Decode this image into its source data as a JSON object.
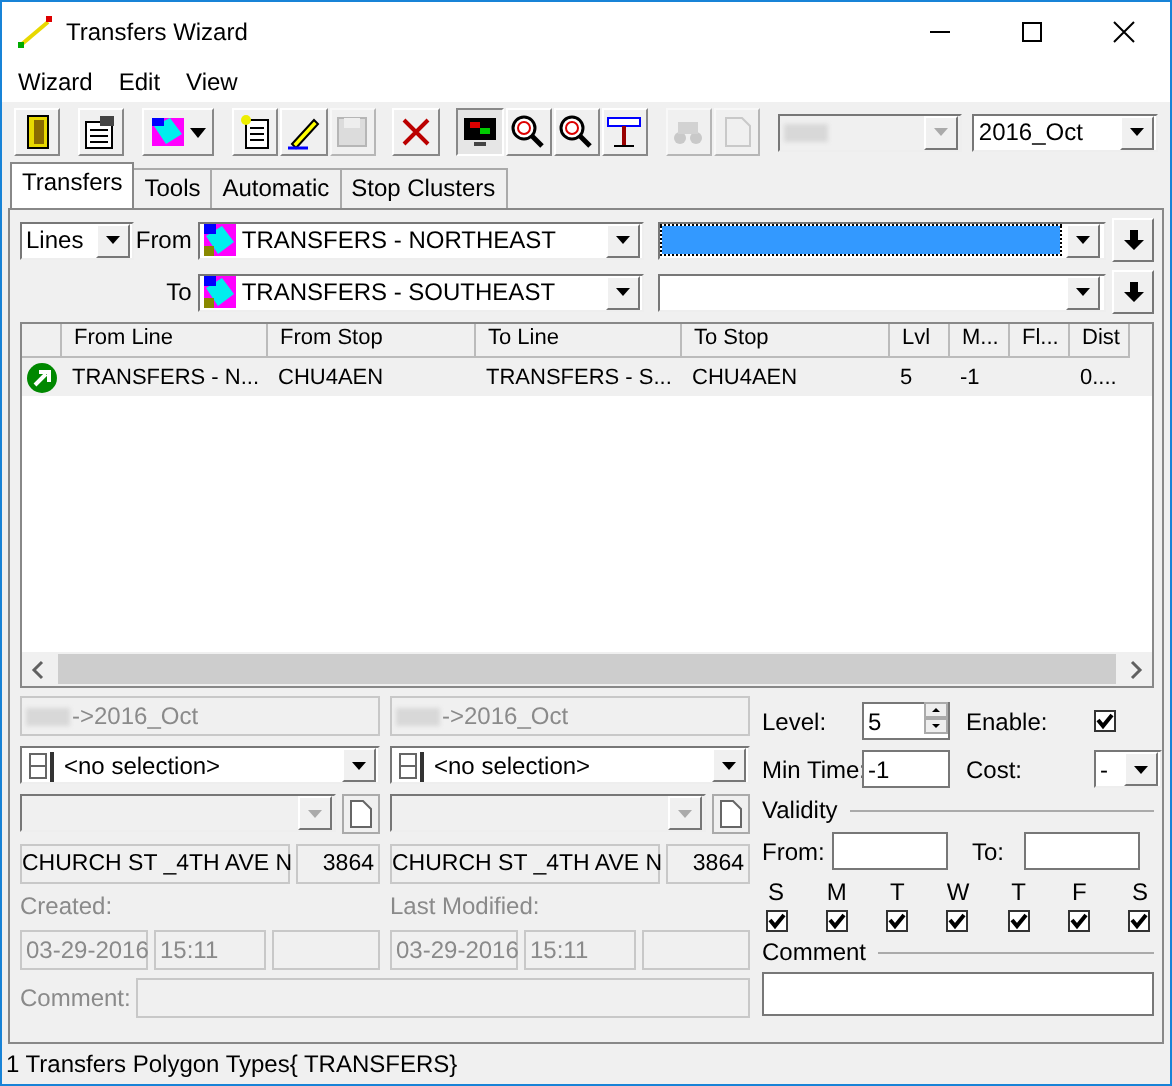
{
  "window": {
    "title": "Transfers Wizard"
  },
  "menu": [
    "Wizard",
    "Edit",
    "View"
  ],
  "toolbar": {
    "buttons": [
      {
        "kind": "door",
        "disabled": false,
        "pressed": false,
        "separator_before": false,
        "has_menu": false
      },
      {
        "kind": "properties",
        "disabled": false,
        "pressed": false,
        "separator_before": true,
        "has_menu": false
      },
      {
        "kind": "layers",
        "disabled": false,
        "pressed": false,
        "separator_before": true,
        "has_menu": true
      },
      {
        "kind": "new",
        "disabled": false,
        "pressed": false,
        "separator_before": true,
        "has_menu": false
      },
      {
        "kind": "pencil",
        "disabled": false,
        "pressed": false,
        "separator_before": false,
        "has_menu": false
      },
      {
        "kind": "save",
        "disabled": true,
        "pressed": false,
        "separator_before": false,
        "has_menu": false
      },
      {
        "kind": "delete",
        "disabled": false,
        "pressed": false,
        "separator_before": true,
        "has_menu": false
      },
      {
        "kind": "map",
        "disabled": false,
        "pressed": true,
        "separator_before": true,
        "has_menu": false
      },
      {
        "kind": "zoom-l",
        "disabled": false,
        "pressed": false,
        "separator_before": false,
        "has_menu": false
      },
      {
        "kind": "zoom-s",
        "disabled": false,
        "pressed": false,
        "separator_before": false,
        "has_menu": false
      },
      {
        "kind": "ruler",
        "disabled": false,
        "pressed": false,
        "separator_before": false,
        "has_menu": false
      },
      {
        "kind": "binoculars",
        "disabled": true,
        "pressed": false,
        "separator_before": true,
        "has_menu": false
      },
      {
        "kind": "page",
        "disabled": true,
        "pressed": false,
        "separator_before": false,
        "has_menu": false
      }
    ],
    "scenario_combo": {
      "disabled": true
    },
    "period_combo": {
      "value": "2016_Oct",
      "disabled": false
    }
  },
  "tabs": [
    {
      "label": "Transfers",
      "selected": true
    },
    {
      "label": "Tools",
      "selected": false
    },
    {
      "label": "Automatic",
      "selected": false
    },
    {
      "label": "Stop Clusters",
      "selected": false
    }
  ],
  "filter": {
    "mode": "Lines",
    "rows": [
      {
        "label": "From",
        "layer": "TRANSFERS - NORTHEAST",
        "highlighted": true
      },
      {
        "label": "To",
        "layer": "TRANSFERS - SOUTHEAST",
        "highlighted": false
      }
    ]
  },
  "table": {
    "columns": [
      "From Line",
      "From Stop",
      "To Line",
      "To Stop",
      "Lvl",
      "M...",
      "Fl...",
      "Dist"
    ],
    "rows": [
      {
        "enabled": true,
        "cells": [
          "TRANSFERS - N...",
          "CHU4AEN",
          "TRANSFERS - S...",
          "CHU4AEN",
          "5",
          "-1",
          "",
          "0...."
        ]
      }
    ]
  },
  "sides": [
    {
      "period": "->2016_Oct",
      "stop_combo": "<no selection>",
      "stop_name": "CHURCH ST _4TH AVE N",
      "stop_id": "3864",
      "stamp_label": "Created:",
      "date": "03-29-2016",
      "time": "15:11"
    },
    {
      "period": "->2016_Oct",
      "stop_combo": "<no selection>",
      "stop_name": "CHURCH ST _4TH AVE N",
      "stop_id": "3864",
      "stamp_label": "Last Modified:",
      "date": "03-29-2016",
      "time": "15:11"
    }
  ],
  "comment_label": "Comment:",
  "settings": {
    "level": {
      "label": "Level:",
      "value": "5"
    },
    "enable": {
      "label": "Enable:",
      "checked": true
    },
    "min_time": {
      "label": "Min Time:",
      "value": "-1"
    },
    "cost": {
      "label": "Cost:",
      "value": "-"
    },
    "validity": {
      "title": "Validity",
      "from_label": "From:",
      "to_label": "To:",
      "days": [
        {
          "label": "S",
          "checked": true
        },
        {
          "label": "M",
          "checked": true
        },
        {
          "label": "T",
          "checked": true
        },
        {
          "label": "W",
          "checked": true
        },
        {
          "label": "T",
          "checked": true
        },
        {
          "label": "F",
          "checked": true
        },
        {
          "label": "S",
          "checked": true
        }
      ]
    },
    "comment_title": "Comment"
  },
  "status_bar": "1 Transfers Polygon Types{ TRANSFERS}"
}
